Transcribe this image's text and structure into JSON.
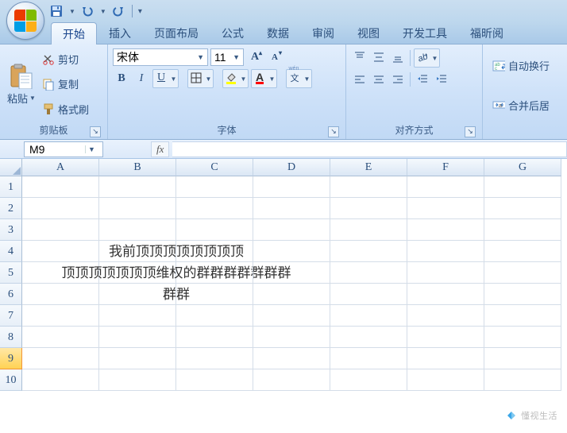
{
  "qat": {
    "save": "save",
    "undo": "undo",
    "redo": "redo"
  },
  "tabs": [
    "开始",
    "插入",
    "页面布局",
    "公式",
    "数据",
    "审阅",
    "视图",
    "开发工具",
    "福昕阅"
  ],
  "active_tab": 0,
  "clipboard": {
    "paste": "粘贴",
    "cut": "剪切",
    "copy": "复制",
    "format_painter": "格式刷",
    "group_label": "剪贴板"
  },
  "font": {
    "name": "宋体",
    "size": "11",
    "group_label": "字体",
    "bold": "B",
    "italic": "I",
    "underline": "U"
  },
  "alignment": {
    "group_label": "对齐方式"
  },
  "wrap": {
    "wrap_text": "自动换行",
    "merge": "合并后居"
  },
  "namebox": "M9",
  "fx_label": "fx",
  "columns": [
    "A",
    "B",
    "C",
    "D",
    "E",
    "F",
    "G"
  ],
  "rows": [
    "1",
    "2",
    "3",
    "4",
    "5",
    "6",
    "7",
    "8",
    "9",
    "10"
  ],
  "active_row_index": 8,
  "content": {
    "line1": "我前顶顶顶顶顶顶顶顶",
    "line2": "顶顶顶顶顶顶顶维权的群群群群群群群",
    "line3": "群群"
  },
  "watermark": "懂视生活"
}
